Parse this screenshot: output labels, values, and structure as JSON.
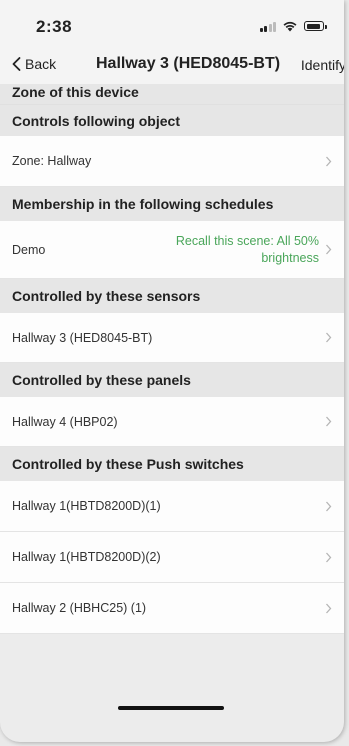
{
  "status_bar": {
    "time": "2:38"
  },
  "nav": {
    "back_label": "Back",
    "title": "Hallway 3 (HED8045-BT)",
    "identify_label": "Identify"
  },
  "sections": {
    "zone_header": "Zone of this device",
    "controls_header": "Controls following object",
    "zone_row": "Zone: Hallway",
    "schedules_header": "Membership in the following schedules",
    "schedule_row": {
      "label": "Demo",
      "detail": "Recall this scene: All 50% brightness"
    },
    "sensors_header": "Controlled by these sensors",
    "sensor_row": "Hallway 3 (HED8045-BT)",
    "panels_header": "Controlled by these panels",
    "panel_row": "Hallway 4 (HBP02)",
    "push_header": "Controlled by these Push switches",
    "push_rows": [
      "Hallway 1(HBTD8200D)(1)",
      "Hallway 1(HBTD8200D)(2)",
      "Hallway 2 (HBHC25) (1)"
    ]
  },
  "colors": {
    "detail_green": "#4aa65a",
    "header_bg": "#e6e6e6"
  },
  "icons": {
    "row_chevron": "chevron-right-icon",
    "back": "chevron-left-icon"
  }
}
